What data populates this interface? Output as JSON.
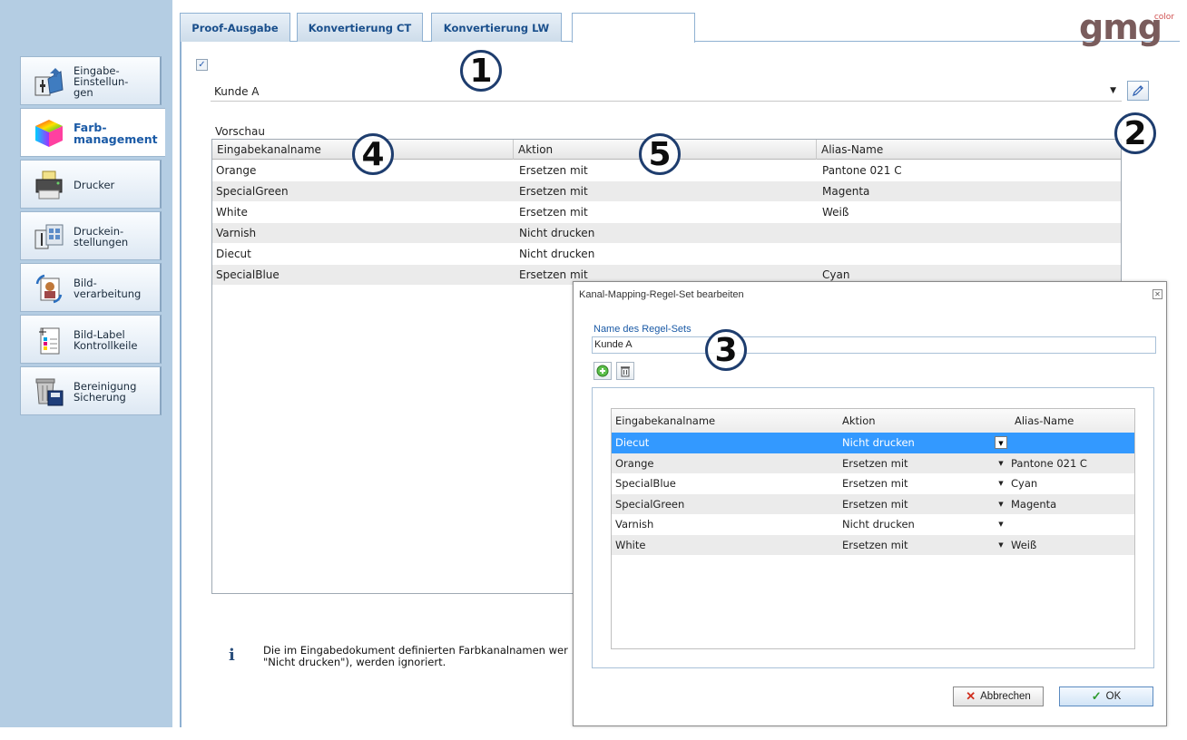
{
  "sidebar": {
    "items": [
      {
        "label": "Eingabe-\nEinstellun-\ngen",
        "icon": "input-settings-icon",
        "active": false
      },
      {
        "label": "Farb-\nmanagement",
        "icon": "color-cube-icon",
        "active": true
      },
      {
        "label": "Drucker",
        "icon": "printer-icon",
        "active": false
      },
      {
        "label": "Druckein-\nstellungen",
        "icon": "print-settings-icon",
        "active": false
      },
      {
        "label": "Bild-\nverarbeitung",
        "icon": "image-processing-icon",
        "active": false
      },
      {
        "label": "Bild-Label\nKontrollkeile",
        "icon": "image-label-icon",
        "active": false
      },
      {
        "label": "Bereinigung\nSicherung",
        "icon": "cleanup-backup-icon",
        "active": false
      }
    ]
  },
  "tabs": [
    {
      "label": "Proof-Ausgabe"
    },
    {
      "label": "Konvertierung CT"
    },
    {
      "label": "Konvertierung LW"
    },
    {
      "label": ""
    }
  ],
  "logo": {
    "text": "gmg",
    "sub": "color"
  },
  "main": {
    "checkbox_checked": true,
    "rule_select_value": "Kunde A",
    "preview_label": "Vorschau",
    "preview_columns": [
      "Eingabekanalname",
      "Aktion",
      "Alias-Name"
    ],
    "preview_rows": [
      {
        "name": "Orange",
        "action": "Ersetzen mit",
        "alias": "Pantone 021 C"
      },
      {
        "name": "SpecialGreen",
        "action": "Ersetzen mit",
        "alias": "Magenta"
      },
      {
        "name": "White",
        "action": "Ersetzen mit",
        "alias": "Weiß"
      },
      {
        "name": "Varnish",
        "action": "Nicht drucken",
        "alias": ""
      },
      {
        "name": "Diecut",
        "action": "Nicht drucken",
        "alias": ""
      },
      {
        "name": "SpecialBlue",
        "action": "Ersetzen mit",
        "alias": "Cyan"
      }
    ],
    "info_text": "Die im Eingabedokument definierten Farbkanalnamen wer\n\"Nicht drucken\"), werden ignoriert."
  },
  "dialog": {
    "title": "Kanal-Mapping-Regel-Set bearbeiten",
    "name_label": "Name des Regel-Sets",
    "name_value": "Kunde A",
    "columns": [
      "Eingabekanalname",
      "Aktion",
      "Alias-Name"
    ],
    "rows": [
      {
        "name": "Diecut",
        "action": "Nicht drucken",
        "alias": "",
        "selected": true
      },
      {
        "name": "Orange",
        "action": "Ersetzen mit",
        "alias": "Pantone 021 C",
        "selected": false
      },
      {
        "name": "SpecialBlue",
        "action": "Ersetzen mit",
        "alias": "Cyan",
        "selected": false
      },
      {
        "name": "SpecialGreen",
        "action": "Ersetzen mit",
        "alias": "Magenta",
        "selected": false
      },
      {
        "name": "Varnish",
        "action": "Nicht drucken",
        "alias": "",
        "selected": false
      },
      {
        "name": "White",
        "action": "Ersetzen mit",
        "alias": "Weiß",
        "selected": false
      }
    ],
    "cancel_label": "Abbrechen",
    "ok_label": "OK"
  },
  "callouts": [
    "1",
    "2",
    "3",
    "4",
    "5"
  ],
  "colors": {
    "accent": "#1a5aa6",
    "sidebar_bg": "#b4cde3",
    "selection": "#3399ff"
  }
}
